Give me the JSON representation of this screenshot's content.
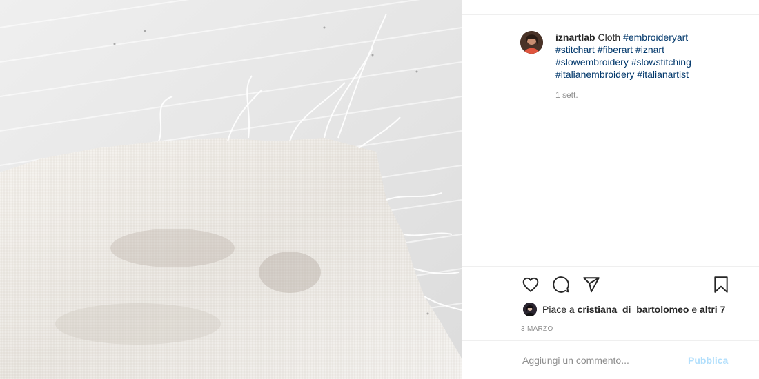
{
  "post": {
    "username": "iznartlab",
    "caption_prefix": "Cloth",
    "hashtags": [
      "#embroideryart",
      "#stitchart",
      "#fiberart",
      "#iznart",
      "#slowembroidery",
      "#slowstitching",
      "#italianembroidery",
      "#italianartist"
    ],
    "time_ago": "1 sett.",
    "image_description_icon": "photo-of-frayed-cloth"
  },
  "likes": {
    "prefix": "Piace a",
    "first_user": "cristiana_di_bartolomeo",
    "conjunction": "e",
    "others": "altri 7"
  },
  "date_label": "3 MARZO",
  "comment": {
    "placeholder": "Aggiungi un commento...",
    "publish_label": "Pubblica"
  },
  "icons": {
    "like": "heart-icon",
    "comment": "comment-bubble-icon",
    "share": "paper-plane-icon",
    "save": "bookmark-icon"
  },
  "colors": {
    "hashtag": "#00376b",
    "publish_disabled": "#b2dffc",
    "muted": "#8e8e8e"
  }
}
